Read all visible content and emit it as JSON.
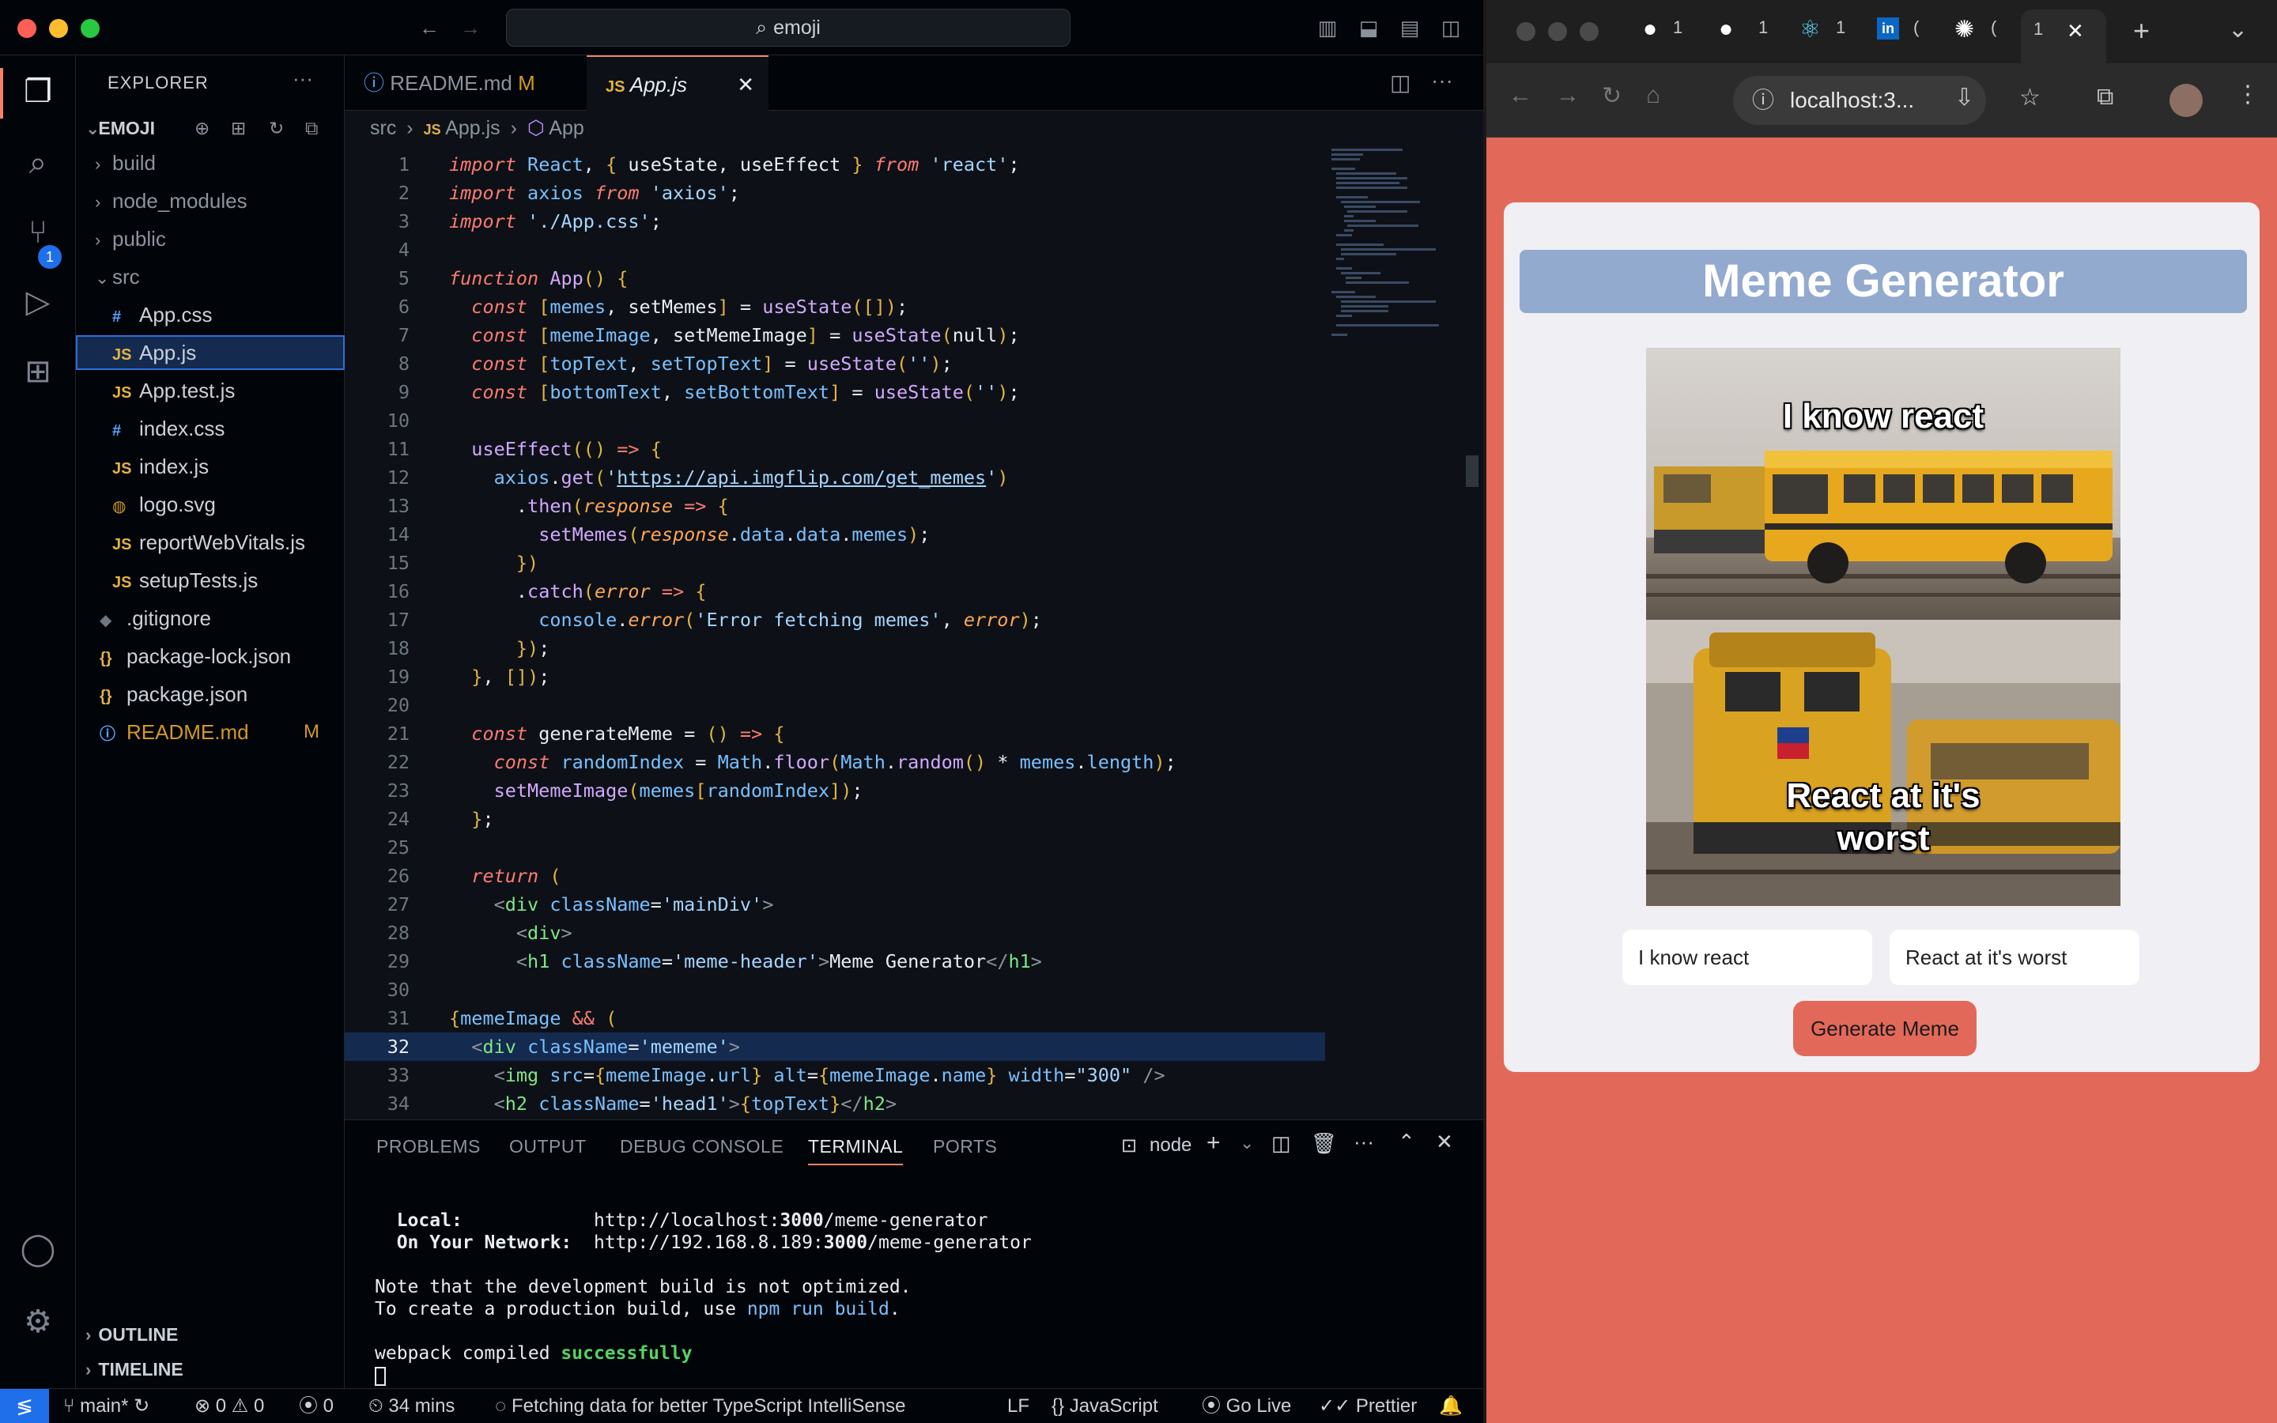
{
  "vscode": {
    "command_center": "emoji",
    "sidebar": {
      "title": "EXPLORER",
      "folder": "EMOJI",
      "items": [
        {
          "label": "build",
          "kind": "folder"
        },
        {
          "label": "node_modules",
          "kind": "folder"
        },
        {
          "label": "public",
          "kind": "folder"
        },
        {
          "label": "src",
          "kind": "folder-open"
        },
        {
          "label": "App.css",
          "kind": "css"
        },
        {
          "label": "App.js",
          "kind": "js"
        },
        {
          "label": "App.test.js",
          "kind": "js"
        },
        {
          "label": "index.css",
          "kind": "css"
        },
        {
          "label": "index.js",
          "kind": "js"
        },
        {
          "label": "logo.svg",
          "kind": "svg"
        },
        {
          "label": "reportWebVitals.js",
          "kind": "js"
        },
        {
          "label": "setupTests.js",
          "kind": "js"
        },
        {
          "label": ".gitignore",
          "kind": "git"
        },
        {
          "label": "package-lock.json",
          "kind": "json"
        },
        {
          "label": "package.json",
          "kind": "json"
        },
        {
          "label": "README.md",
          "kind": "md",
          "tag": "M"
        }
      ],
      "outline": "OUTLINE",
      "timeline": "TIMELINE"
    },
    "source_control_badge": "1",
    "tabs": [
      {
        "label": "README.md",
        "tag": "M"
      },
      {
        "label": "App.js"
      }
    ],
    "breadcrumb": {
      "folder": "src",
      "file": "App.js",
      "symbol": "App"
    },
    "current_line": 32,
    "code_lines": [
      "import React, { useState, useEffect } from 'react';",
      "import axios from 'axios';",
      "import './App.css';",
      "",
      "function App() {",
      "  const [memes, setMemes] = useState([]);",
      "  const [memeImage, setMemeImage] = useState(null);",
      "  const [topText, setTopText] = useState('');",
      "  const [bottomText, setBottomText] = useState('');",
      "",
      "  useEffect(() => {",
      "    axios.get('https://api.imgflip.com/get_memes')",
      "      .then(response => {",
      "        setMemes(response.data.data.memes);",
      "      })",
      "      .catch(error => {",
      "        console.error('Error fetching memes', error);",
      "      });",
      "  }, []);",
      "",
      "  const generateMeme = () => {",
      "    const randomIndex = Math.floor(Math.random() * memes.length);",
      "    setMemeImage(memes[randomIndex]);",
      "  };",
      "",
      "  return (",
      "    <div className='mainDiv'>",
      "      <div>",
      "      <h1 className='meme-header'>Meme Generator</h1>",
      "",
      "{memeImage && (",
      "  <div className='mememe'>",
      "    <img src={memeImage.url} alt={memeImage.name} width=\"300\" />",
      "    <h2 className='head1'>{topText}</h2>"
    ],
    "panel": {
      "tabs": [
        "PROBLEMS",
        "OUTPUT",
        "DEBUG CONSOLE",
        "TERMINAL",
        "PORTS"
      ],
      "active_tab": "TERMINAL",
      "shell": "node",
      "terminal": {
        "local_label": "Local:",
        "local_url_a": "http://localhost:",
        "local_port": "3000",
        "local_url_b": "/meme-generator",
        "network_label": "On Your Network:",
        "network_url_a": "http://192.168.8.189:",
        "network_port": "3000",
        "network_url_b": "/meme-generator",
        "note1": "Note that the development build is not optimized.",
        "note2a": "To create a production build, use ",
        "note2b": "npm run build",
        "note2c": ".",
        "compiled_a": "webpack compiled ",
        "compiled_b": "successfully"
      }
    },
    "statusbar": {
      "branch": "main*",
      "errors": "0",
      "warnings": "0",
      "ports": "0",
      "time": "34 mins",
      "message": "Fetching data for better TypeScript IntelliSense",
      "eol": "LF",
      "language": "JavaScript",
      "golive": "Go Live",
      "prettier": "Prettier"
    }
  },
  "browser": {
    "address": "localhost:3...",
    "tab_labels": [
      "1",
      "1",
      "1",
      "(",
      "(",
      "1"
    ],
    "page": {
      "header": "Meme Generator",
      "top_caption": "I know react",
      "bottom_caption": "React at it's worst",
      "top_input_value": "I know react",
      "bottom_input_value": "React at it's worst",
      "button_label": "Generate Meme"
    }
  },
  "colors": {
    "page_bg": "#e2695a",
    "header_bg": "#93aacf",
    "editor_bg": "#0d1117",
    "selection": "#152a4f"
  }
}
